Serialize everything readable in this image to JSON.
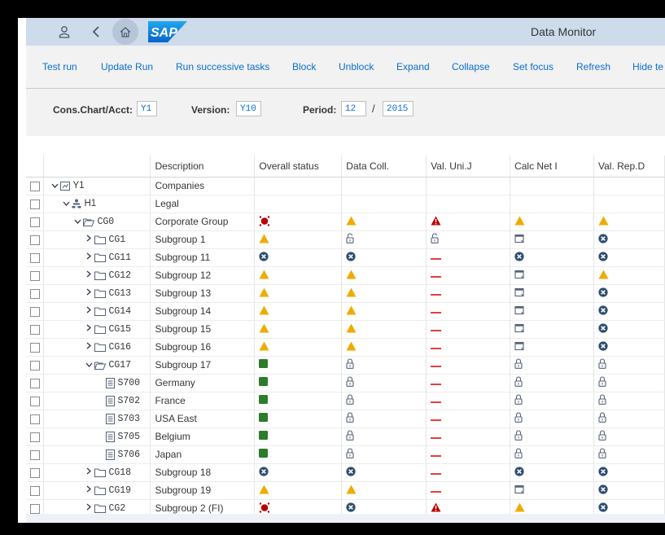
{
  "shell": {
    "title": "Data Monitor",
    "logo": "SAP"
  },
  "toolbar": {
    "buttons": [
      "Test run",
      "Update Run",
      "Run successive tasks",
      "Block",
      "Unblock",
      "Expand",
      "Collapse",
      "Set focus",
      "Refresh",
      "Hide te"
    ]
  },
  "filters": {
    "chart_label": "Cons.Chart/Acct:",
    "chart_value": "Y1",
    "version_label": "Version:",
    "version_value": "Y10",
    "period_label": "Period:",
    "period_value": "12",
    "separator": "/",
    "year_value": "2015"
  },
  "columns": [
    "Description",
    "Overall status",
    "Data Coll.",
    "Val. Uni.J",
    "Calc Net I",
    "Val. Rep.D"
  ],
  "rows": [
    {
      "level": 0,
      "twisty": "expanded",
      "icon": "hierarchy-icon",
      "code": "Y1",
      "desc": "Companies",
      "status": [
        "",
        "",
        "",
        "",
        ""
      ]
    },
    {
      "level": 1,
      "twisty": "expanded",
      "icon": "org-icon",
      "code": "H1",
      "desc": "Legal",
      "status": [
        "",
        "",
        "",
        "",
        ""
      ]
    },
    {
      "level": 2,
      "twisty": "expanded",
      "icon": "folder-open-icon",
      "code": "CG0",
      "desc": "Corporate Group",
      "status": [
        "alarm",
        "warn",
        "error",
        "warn",
        "warn"
      ]
    },
    {
      "level": 3,
      "twisty": "collapsed",
      "icon": "folder-icon",
      "code": "CG1",
      "desc": "Subgroup 1",
      "status": [
        "warn",
        "unlock",
        "unlock",
        "task",
        "x"
      ]
    },
    {
      "level": 3,
      "twisty": "collapsed",
      "icon": "folder-icon",
      "code": "CG11",
      "desc": "Subgroup 11",
      "status": [
        "x",
        "x",
        "dash",
        "x",
        "x"
      ]
    },
    {
      "level": 3,
      "twisty": "collapsed",
      "icon": "folder-icon",
      "code": "CG12",
      "desc": "Subgroup 12",
      "status": [
        "warn",
        "warn",
        "dash",
        "task",
        "warn"
      ]
    },
    {
      "level": 3,
      "twisty": "collapsed",
      "icon": "folder-icon",
      "code": "CG13",
      "desc": "Subgroup 13",
      "status": [
        "warn",
        "warn",
        "dash",
        "task",
        "x"
      ]
    },
    {
      "level": 3,
      "twisty": "collapsed",
      "icon": "folder-icon",
      "code": "CG14",
      "desc": "Subgroup 14",
      "status": [
        "warn",
        "warn",
        "dash",
        "task",
        "x"
      ]
    },
    {
      "level": 3,
      "twisty": "collapsed",
      "icon": "folder-icon",
      "code": "CG15",
      "desc": "Subgroup 15",
      "status": [
        "warn",
        "warn",
        "dash",
        "task",
        "x"
      ]
    },
    {
      "level": 3,
      "twisty": "collapsed",
      "icon": "folder-icon",
      "code": "CG16",
      "desc": "Subgroup 16",
      "status": [
        "warn",
        "warn",
        "dash",
        "task",
        "x"
      ]
    },
    {
      "level": 3,
      "twisty": "expanded",
      "icon": "folder-open-icon",
      "code": "CG17",
      "desc": "Subgroup 17",
      "status": [
        "ok",
        "lock",
        "dash",
        "lock",
        "lock"
      ]
    },
    {
      "level": 4,
      "twisty": "none",
      "icon": "document-icon",
      "code": "S700",
      "desc": "Germany",
      "status": [
        "ok",
        "lock",
        "dash",
        "lock",
        "lock"
      ]
    },
    {
      "level": 4,
      "twisty": "none",
      "icon": "document-icon",
      "code": "S702",
      "desc": "France",
      "status": [
        "ok",
        "lock",
        "dash",
        "lock",
        "lock"
      ]
    },
    {
      "level": 4,
      "twisty": "none",
      "icon": "document-icon",
      "code": "S703",
      "desc": "USA East",
      "status": [
        "ok",
        "lock",
        "dash",
        "lock",
        "lock"
      ]
    },
    {
      "level": 4,
      "twisty": "none",
      "icon": "document-icon",
      "code": "S705",
      "desc": "Belgium",
      "status": [
        "ok",
        "lock",
        "dash",
        "lock",
        "lock"
      ]
    },
    {
      "level": 4,
      "twisty": "none",
      "icon": "document-icon",
      "code": "S706",
      "desc": "Japan",
      "status": [
        "ok",
        "lock",
        "dash",
        "lock",
        "lock"
      ]
    },
    {
      "level": 3,
      "twisty": "collapsed",
      "icon": "folder-icon",
      "code": "CG18",
      "desc": "Subgroup 18",
      "status": [
        "x",
        "x",
        "dash",
        "x",
        "x"
      ]
    },
    {
      "level": 3,
      "twisty": "collapsed",
      "icon": "folder-icon",
      "code": "CG19",
      "desc": "Subgroup 19",
      "status": [
        "warn",
        "warn",
        "dash",
        "task",
        "x"
      ]
    },
    {
      "level": 3,
      "twisty": "collapsed",
      "icon": "folder-icon",
      "code": "CG2",
      "desc": "Subgroup 2 (FI)",
      "status": [
        "alarm",
        "x",
        "error",
        "warn",
        "x"
      ]
    }
  ],
  "status_icon_names": {
    "warn": "warning-triangle-icon",
    "error": "error-triangle-icon",
    "alarm": "alarm-clock-icon",
    "x": "cancel-circle-icon",
    "dash": "not-relevant-dash-icon",
    "ok": "completed-square-icon",
    "lock": "lock-icon",
    "unlock": "unlock-icon",
    "task": "task-pending-icon"
  },
  "colors": {
    "warning": "#f0ab00",
    "error": "#bb0000",
    "cancel": "#2b4d6e",
    "ok": "#2b7c2b",
    "dash": "#e04040",
    "link": "#0a6ed1",
    "shell": "#cddbea"
  }
}
